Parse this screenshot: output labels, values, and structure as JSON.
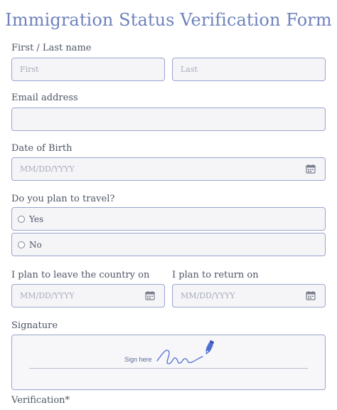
{
  "form": {
    "title": "Immigration Status Verification Form",
    "name": {
      "label": "First / Last name",
      "first_placeholder": "First",
      "last_placeholder": "Last"
    },
    "email": {
      "label": "Email address",
      "placeholder": ""
    },
    "dob": {
      "label": "Date of Birth",
      "placeholder": "MM/DD/YYYY"
    },
    "travel": {
      "label": "Do you plan to travel?",
      "options": [
        "Yes",
        "No"
      ]
    },
    "leave": {
      "label": "I plan to leave the country on",
      "placeholder": "MM/DD/YYYY"
    },
    "return": {
      "label": "I plan to return on",
      "placeholder": "MM/DD/YYYY"
    },
    "signature": {
      "label": "Signature",
      "hint": "Sign here"
    },
    "verification": {
      "label": "Verification*"
    }
  },
  "colors": {
    "accent": "#6f82bd",
    "border": "#9aa5cc",
    "field_bg": "#f5f5f8",
    "pen": "#4f6fcf"
  },
  "icons": {
    "calendar": "calendar-icon",
    "pen": "pen-icon"
  }
}
